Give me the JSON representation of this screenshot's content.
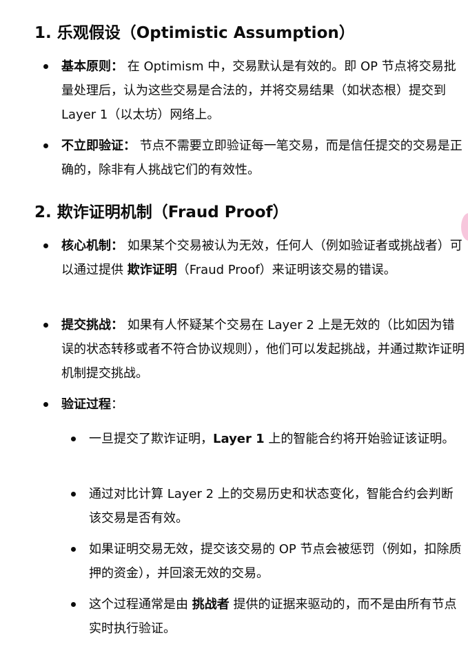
{
  "sections": [
    {
      "heading": "1. 乐观假设（Optimistic Assumption）",
      "items": [
        {
          "label": "基本原则：",
          "text": " 在 Optimism 中，交易默认是有效的。即 OP 节点将交易批量处理后，认为这些交易是合法的，并将交易结果（如状态根）提交到 Layer 1（以太坊）网络上。"
        },
        {
          "label": "不立即验证：",
          "text": " 节点不需要立即验证每一笔交易，而是信任提交的交易是正确的，除非有人挑战它们的有效性。"
        }
      ]
    },
    {
      "heading": "2. 欺诈证明机制（Fraud Proof）",
      "items": [
        {
          "label": "核心机制：",
          "text_before": " 如果某个交易被认为无效，任何人（例如验证者或挑战者）可以通过提供 ",
          "strong": "欺诈证明",
          "text_after": "（Fraud Proof）来证明该交易的错误。"
        },
        {
          "label": "提交挑战：",
          "text": " 如果有人怀疑某个交易在 Layer 2 上是无效的（比如因为错误的状态转移或者不符合协议规则），他们可以发起挑战，并通过欺诈证明机制提交挑战。"
        },
        {
          "label": "验证过程",
          "label_suffix": "：",
          "sub_items": [
            {
              "text_before": "一旦提交了欺诈证明，",
              "strong": "Layer 1",
              "text_after": " 上的智能合约将开始验证该证明。"
            },
            {
              "text": "通过对比计算 Layer 2 上的交易历史和状态变化，智能合约会判断该交易是否有效。"
            },
            {
              "text": "如果证明交易无效，提交该交易的 OP 节点会被惩罚（例如，扣除质押的资金），并回滚无效的交易。"
            },
            {
              "text_before": "这个过程通常是由 ",
              "strong": "挑战者",
              "text_after": " 提供的证据来驱动的，而不是由所有节点实时执行验证。"
            }
          ]
        }
      ]
    }
  ]
}
